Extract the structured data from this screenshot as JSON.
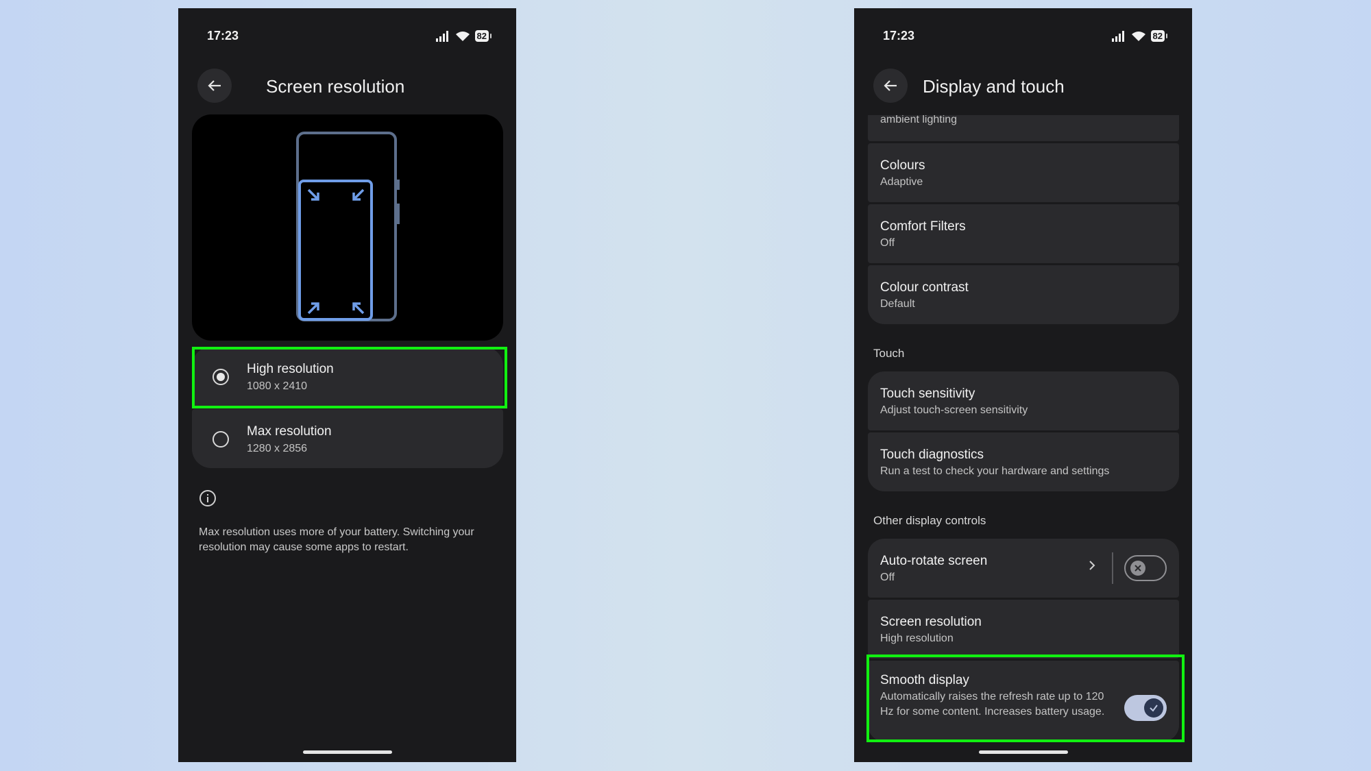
{
  "left_phone": {
    "status": {
      "time": "17:23",
      "battery": "82"
    },
    "title": "Screen resolution",
    "options": [
      {
        "title": "High resolution",
        "subtitle": "1080 x 2410",
        "selected": true
      },
      {
        "title": "Max resolution",
        "subtitle": "1280 x 2856",
        "selected": false
      }
    ],
    "info_text": "Max resolution uses more of your battery. Switching your resolution may cause some apps to restart."
  },
  "right_phone": {
    "status": {
      "time": "17:23",
      "battery": "82"
    },
    "title": "Display and touch",
    "partial_item": "ambient lighting",
    "display_items": [
      {
        "title": "Colours",
        "subtitle": "Adaptive"
      },
      {
        "title": "Comfort Filters",
        "subtitle": "Off"
      },
      {
        "title": "Colour contrast",
        "subtitle": "Default"
      }
    ],
    "touch_header": "Touch",
    "touch_items": [
      {
        "title": "Touch sensitivity",
        "subtitle": "Adjust touch-screen sensitivity"
      },
      {
        "title": "Touch diagnostics",
        "subtitle": "Run a test to check your hardware and settings"
      }
    ],
    "other_header": "Other display controls",
    "auto_rotate": {
      "title": "Auto-rotate screen",
      "subtitle": "Off",
      "enabled": false
    },
    "screen_resolution": {
      "title": "Screen resolution",
      "subtitle": "High resolution"
    },
    "smooth_display": {
      "title": "Smooth display",
      "subtitle": "Automatically raises the refresh rate up to 120 Hz for some content. Increases battery usage.",
      "enabled": true
    }
  },
  "colors": {
    "highlight": "#11f011",
    "accent_blue": "#6f9de8",
    "toggle_on": "#bdc7e0"
  },
  "icons": [
    "back-arrow-icon",
    "signal-icon",
    "wifi-icon",
    "battery-icon",
    "info-icon",
    "chevron-right-icon",
    "close-icon",
    "check-icon"
  ]
}
